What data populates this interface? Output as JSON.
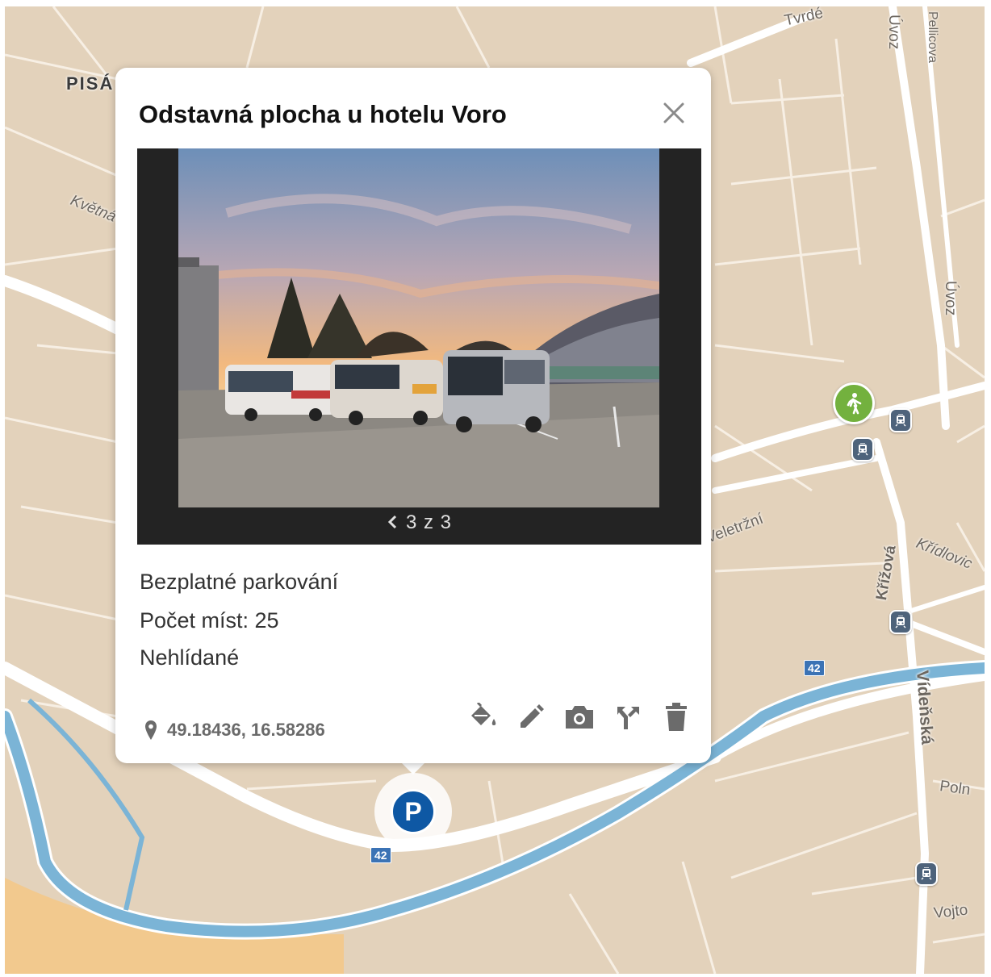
{
  "map": {
    "streets": {
      "pisarky": "PISÁ",
      "kvetna": "Květná",
      "uvoz_top": "Úvoz",
      "uvoz_right": "Úvoz",
      "pellicova": "Pellicova",
      "veletrzni": "Veletržní",
      "krizova": "Křížová",
      "kridlovicka": "Křídlovic",
      "videnska": "Vídeňská",
      "polni": "Poln",
      "vojtova": "Vojto",
      "tvrdeho": "Tvrdé"
    },
    "road_numbers": [
      "42",
      "42"
    ],
    "icons": {
      "tram": "tram-stop-icon",
      "pedestrian": "pedestrian-icon",
      "parking": "parking-marker"
    },
    "parking_label": "P",
    "colors": {
      "land": "#e3d2bb",
      "water": "#7bb4d6",
      "road": "#ffffff",
      "park": "#f2c98e",
      "parking_marker": "#0e58a4",
      "pedestrian_marker": "#73b13e",
      "tram_marker": "#4e637b"
    }
  },
  "popup": {
    "title": "Odstavná plocha u hotelu Voro",
    "gallery": {
      "counter": "3 z 3"
    },
    "details": {
      "price": "Bezplatné parkování",
      "capacity": "Počet míst: 25",
      "guarded": "Nehlídané"
    },
    "coordinates": "49.18436, 16.58286",
    "actions": {
      "color": "format-color-fill-icon",
      "edit": "pencil-icon",
      "photo": "camera-icon",
      "directions": "call-split-icon",
      "delete": "trash-icon"
    }
  }
}
